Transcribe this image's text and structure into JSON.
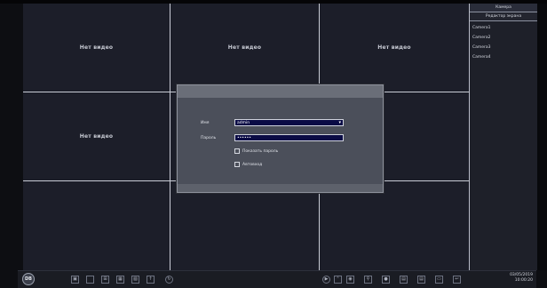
{
  "grid": {
    "cells": [
      "Нет видео",
      "Нет видео",
      "Нет видео",
      "Нет видео",
      "",
      "",
      "",
      "",
      ""
    ]
  },
  "side_panel": {
    "tabs": [
      "Камера",
      "Редактор экрана"
    ],
    "cameras": [
      "Camera1",
      "Camera2",
      "Camera3",
      "Camera4"
    ]
  },
  "login": {
    "user_label": "Имя",
    "user_value": "admin",
    "password_label": "Пароль",
    "password_value": "••••••",
    "show_password_label": "Показать пароль",
    "autologin_label": "Автовход"
  },
  "toolbar": {
    "logo_text": "DB",
    "icons": [
      "split-icon",
      "layout-1-icon",
      "layout-4-icon",
      "layout-9-icon",
      "layout-16-icon",
      "sequence-icon",
      "refresh-icon",
      "play-icon",
      "ptz-icon",
      "camera-icon",
      "search-icon",
      "record-icon",
      "network-icon",
      "disk-icon",
      "backup-icon",
      "logout-icon"
    ]
  },
  "clock": {
    "date": "03/05/2019",
    "time": "10:00:20"
  },
  "colors": {
    "field_bg": "#0a0b45",
    "dialog_bg": "#4b4f5a",
    "grid_line": "#c9ccd6"
  }
}
